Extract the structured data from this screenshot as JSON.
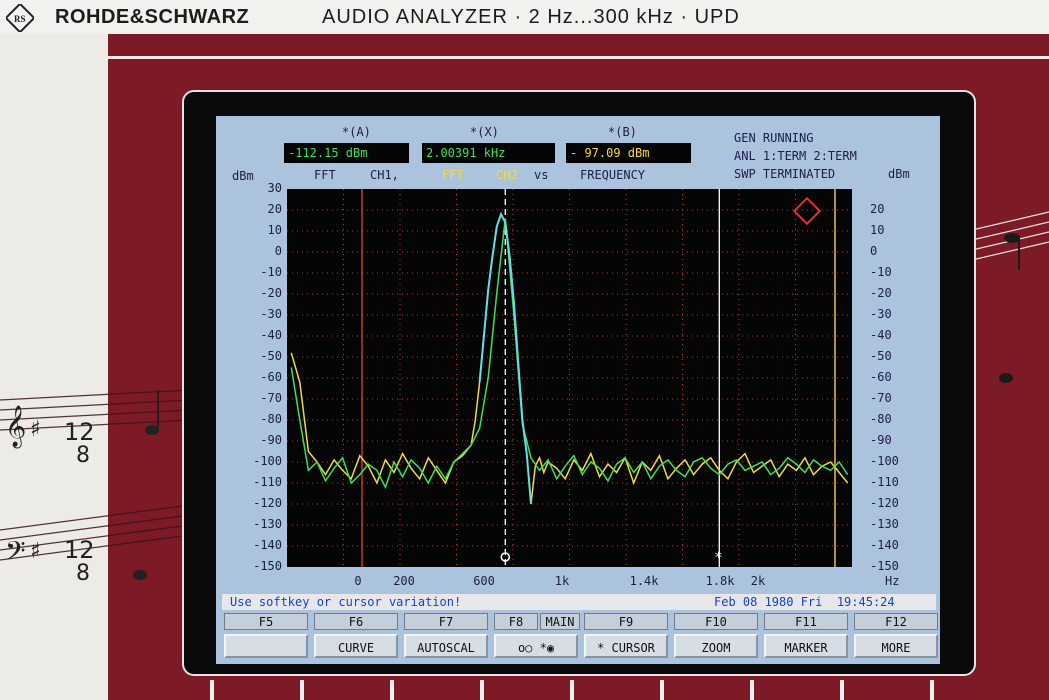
{
  "brand": {
    "name": "ROHDE&SCHWARZ",
    "title": "AUDIO ANALYZER · 2 Hz...300 kHz · UPD"
  },
  "colors": {
    "bezel": "#7c1a26",
    "screen": "#acc3dd",
    "trace_cyan": "#5fe0e6",
    "trace_green": "#3ee05a",
    "trace_yellow": "#f0dc3c",
    "grid": "#c0392b",
    "readout_green": "#3ee05a",
    "readout_yellow": "#f5dc3c"
  },
  "readouts": {
    "a_label": "*(A)",
    "a_value": "-112.15 dBm",
    "x_label": "*(X)",
    "x_value": "2.00391 kHz",
    "b_label": "*(B)",
    "b_value": "- 97.09 dBm"
  },
  "header": {
    "left_unit": "dBm",
    "fft1": "FFT",
    "ch1": "CH1,",
    "fft2": "FFT",
    "ch2": "CH2",
    "vs": "vs",
    "frequency": "FREQUENCY",
    "status1": "GEN RUNNING",
    "status2": "ANL 1:TERM 2:TERM",
    "status3": "SWP TERMINATED",
    "right_unit": "dBm"
  },
  "axes": {
    "y_left": [
      "30",
      "20",
      "10",
      "0",
      "-10",
      "-20",
      "-30",
      "-40",
      "-50",
      "-60",
      "-70",
      "-80",
      "-90",
      "-100",
      "-110",
      "-120",
      "-130",
      "-140",
      "-150"
    ],
    "y_right": [
      "20",
      "10",
      "0",
      "-10",
      "-20",
      "-30",
      "-40",
      "-50",
      "-60",
      "-70",
      "-80",
      "-90",
      "-100",
      "-110",
      "-120",
      "-130",
      "-140",
      "-150"
    ],
    "x": [
      "0",
      "200",
      "600",
      "1k",
      "1.4k",
      "1.8k",
      "2k"
    ],
    "x_unit": "Hz"
  },
  "chart_data": {
    "type": "line",
    "xlabel": "Hz",
    "ylabel": "dBm",
    "xlim": [
      -20,
      2620
    ],
    "ylim": [
      -150,
      30
    ],
    "cursor_x": 1000,
    "marker_x": 2000,
    "series": [
      {
        "x": [
          0,
          40,
          80,
          120,
          160,
          200,
          240,
          280,
          320,
          360,
          400,
          440,
          480,
          520,
          560,
          600,
          640,
          680,
          720,
          760,
          800,
          840,
          860,
          880,
          900,
          920,
          940,
          960,
          980,
          1000,
          1020,
          1040,
          1060,
          1080,
          1100,
          1120,
          1140,
          1160,
          1180,
          1200,
          1240,
          1280,
          1320,
          1360,
          1400,
          1440,
          1480,
          1520,
          1560,
          1600,
          1640,
          1680,
          1720,
          1760,
          1800,
          1840,
          1880,
          1920,
          1960,
          2000,
          2040,
          2080,
          2120,
          2160,
          2200,
          2240,
          2280,
          2320,
          2360,
          2400,
          2440,
          2480,
          2520,
          2560,
          2600
        ],
        "y": [
          -48,
          -62,
          -95,
          -100,
          -106,
          -99,
          -104,
          -108,
          -97,
          -102,
          -110,
          -99,
          -105,
          -96,
          -103,
          -108,
          -98,
          -104,
          -110,
          -100,
          -97,
          -92,
          -80,
          -62,
          -40,
          -18,
          -2,
          12,
          18,
          14,
          -2,
          -24,
          -52,
          -80,
          -96,
          -120,
          -102,
          -98,
          -105,
          -100,
          -103,
          -108,
          -99,
          -104,
          -96,
          -107,
          -101,
          -105,
          -98,
          -110,
          -100,
          -104,
          -97,
          -108,
          -103,
          -99,
          -106,
          -101,
          -98,
          -104,
          -108,
          -100,
          -96,
          -105,
          -102,
          -99,
          -107,
          -101,
          -104,
          -98,
          -106,
          -102,
          -100,
          -105,
          -110
        ]
      },
      {
        "x": [
          0,
          40,
          80,
          120,
          160,
          200,
          240,
          280,
          320,
          360,
          400,
          440,
          480,
          520,
          560,
          600,
          640,
          680,
          720,
          760,
          800,
          840,
          880,
          920,
          960,
          1000,
          1040,
          1080,
          1120,
          1160,
          1200,
          1240,
          1280,
          1320,
          1360,
          1400,
          1440,
          1480,
          1520,
          1560,
          1600,
          1640,
          1680,
          1720,
          1760,
          1800,
          1840,
          1880,
          1920,
          1960,
          2000,
          2040,
          2080,
          2120,
          2160,
          2200,
          2240,
          2280,
          2320,
          2360,
          2400,
          2440,
          2480,
          2520,
          2560,
          2600
        ],
        "y": [
          -55,
          -80,
          -104,
          -100,
          -109,
          -103,
          -98,
          -110,
          -106,
          -101,
          -104,
          -112,
          -100,
          -107,
          -99,
          -103,
          -110,
          -102,
          -108,
          -100,
          -96,
          -92,
          -84,
          -60,
          -20,
          16,
          -30,
          -82,
          -98,
          -104,
          -99,
          -108,
          -102,
          -97,
          -106,
          -100,
          -103,
          -109,
          -101,
          -98,
          -105,
          -100,
          -108,
          -102,
          -99,
          -104,
          -107,
          -100,
          -98,
          -103,
          -106,
          -101,
          -99,
          -104,
          -102,
          -100,
          -106,
          -103,
          -98,
          -101,
          -105,
          -99,
          -102,
          -104,
          -100,
          -106
        ]
      }
    ]
  },
  "status": {
    "message": "Use softkey or cursor variation!",
    "date": "Feb 08 1980 Fri  19:45:24"
  },
  "fkeys": [
    "F5",
    "F6",
    "F7",
    "F8",
    "MAIN",
    "F9",
    "F10",
    "F11",
    "F12"
  ],
  "softkeys": [
    "",
    "CURVE",
    "AUTOSCAL",
    "o○  *◉",
    "* CURSOR",
    "ZOOM",
    "MARKER",
    "MORE"
  ]
}
